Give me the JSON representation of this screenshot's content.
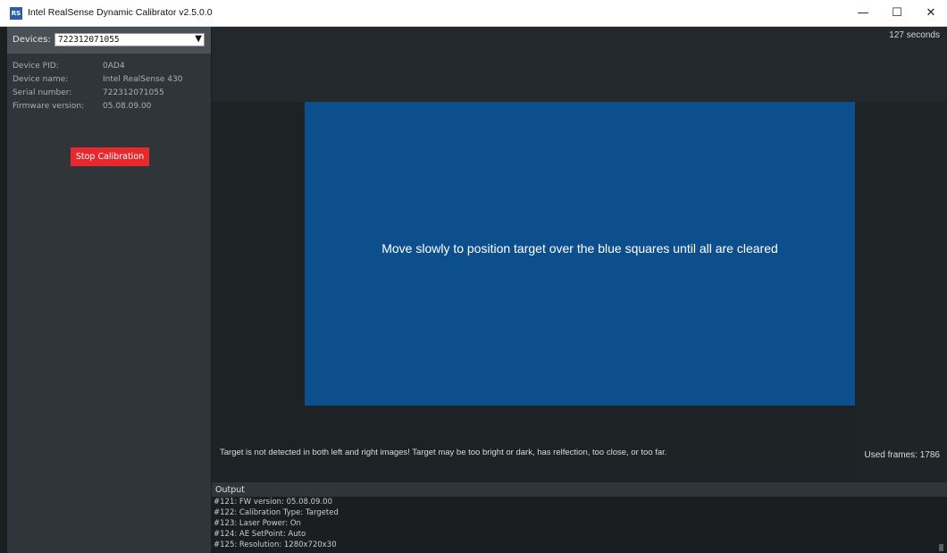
{
  "window": {
    "icon_text": "RS",
    "title": "Intel RealSense Dynamic Calibrator v2.5.0.0",
    "minimize": "—",
    "maximize": "☐",
    "close": "✕"
  },
  "devices": {
    "label": "Devices:",
    "selected": "722312071055",
    "caret": "▼"
  },
  "device_info": [
    {
      "key": "Device PID:",
      "value": "0AD4"
    },
    {
      "key": "Device name:",
      "value": "Intel RealSense 430"
    },
    {
      "key": "Serial number:",
      "value": "722312071055"
    },
    {
      "key": "Firmware version:",
      "value": "05.08.09.00"
    }
  ],
  "stop_button": "Stop Calibration",
  "main": {
    "seconds": "127 seconds",
    "target_message": "Move slowly to position target over the blue squares until all are cleared",
    "detect_message": "Target is not detected in both left and right images! Target may be too bright or dark, has relfection, too close, or too far.",
    "used_frames": "Used frames: 1786"
  },
  "output": {
    "title": "Output",
    "lines": [
      "#121: FW version: 05.08.09.00",
      "#122: Calibration Type: Targeted",
      "#123: Laser Power: On",
      "#124: AE SetPoint: Auto",
      "#125: Resolution: 1280x720x30"
    ]
  },
  "colors": {
    "accent_blue": "#0d4f8d",
    "stop_red": "#e8282d"
  }
}
